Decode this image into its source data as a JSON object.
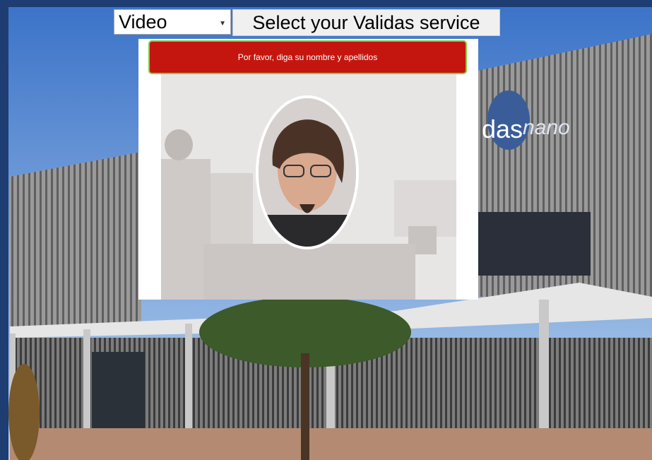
{
  "toolbar": {
    "mode_select_value": "Video",
    "service_button_label": "Select your Validas service"
  },
  "verification": {
    "prompt_text": "Por favor, diga su nombre y apellidos"
  },
  "background": {
    "sign_text": "das"
  },
  "colors": {
    "frame": "#1d3d73",
    "banner_bg": "#c4160f",
    "banner_border": "#7ed040",
    "sky": "#4a84d6"
  }
}
